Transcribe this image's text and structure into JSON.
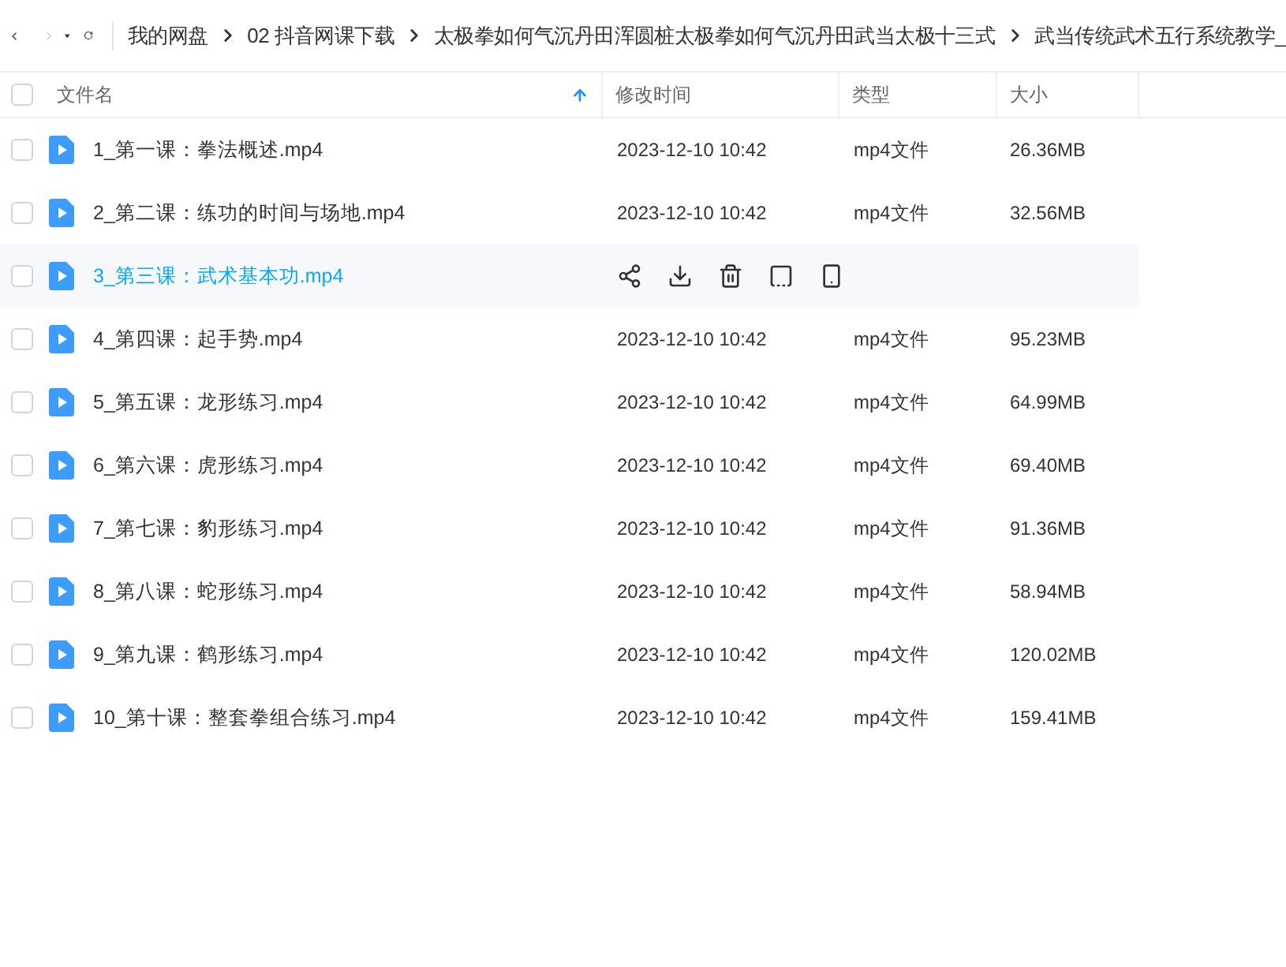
{
  "breadcrumb": [
    "我的网盘",
    "02 抖音网课下载",
    "太极拳如何气沉丹田浑圆桩太极拳如何气沉丹田武当太极十三式",
    "武当传统武术五行系统教学_"
  ],
  "table": {
    "select_all": {
      "checked": false
    },
    "columns": [
      {
        "label": "文件名",
        "sorted": true
      },
      {
        "label": "修改时间",
        "sorted": false
      },
      {
        "label": "类型",
        "sorted": false
      },
      {
        "label": "大小",
        "sorted": false
      }
    ],
    "rows": [
      {
        "name": "1_第一课：拳法概述.mp4",
        "checked": false,
        "hovered": false,
        "modified": "2023-12-10 10:42",
        "type": "mp4文件",
        "size": "26.36MB"
      },
      {
        "name": "2_第二课：练功的时间与场地.mp4",
        "checked": false,
        "hovered": false,
        "modified": "2023-12-10 10:42",
        "type": "mp4文件",
        "size": "32.56MB"
      },
      {
        "name": "3_第三课：武术基本功.mp4",
        "checked": false,
        "hovered": true
      },
      {
        "name": "4_第四课：起手势.mp4",
        "checked": false,
        "hovered": false,
        "modified": "2023-12-10 10:42",
        "type": "mp4文件",
        "size": "95.23MB"
      },
      {
        "name": "5_第五课：龙形练习.mp4",
        "checked": false,
        "hovered": false,
        "modified": "2023-12-10 10:42",
        "type": "mp4文件",
        "size": "64.99MB"
      },
      {
        "name": "6_第六课：虎形练习.mp4",
        "checked": false,
        "hovered": false,
        "modified": "2023-12-10 10:42",
        "type": "mp4文件",
        "size": "69.40MB"
      },
      {
        "name": "7_第七课：豹形练习.mp4",
        "checked": false,
        "hovered": false,
        "modified": "2023-12-10 10:42",
        "type": "mp4文件",
        "size": "91.36MB"
      },
      {
        "name": "8_第八课：蛇形练习.mp4",
        "checked": false,
        "hovered": false,
        "modified": "2023-12-10 10:42",
        "type": "mp4文件",
        "size": "58.94MB"
      },
      {
        "name": "9_第九课：鹤形练习.mp4",
        "checked": false,
        "hovered": false,
        "modified": "2023-12-10 10:42",
        "type": "mp4文件",
        "size": "120.02MB"
      },
      {
        "name": "10_第十课：整套拳组合练习.mp4",
        "checked": false,
        "hovered": false,
        "modified": "2023-12-10 10:42",
        "type": "mp4文件",
        "size": "159.41MB"
      }
    ]
  }
}
